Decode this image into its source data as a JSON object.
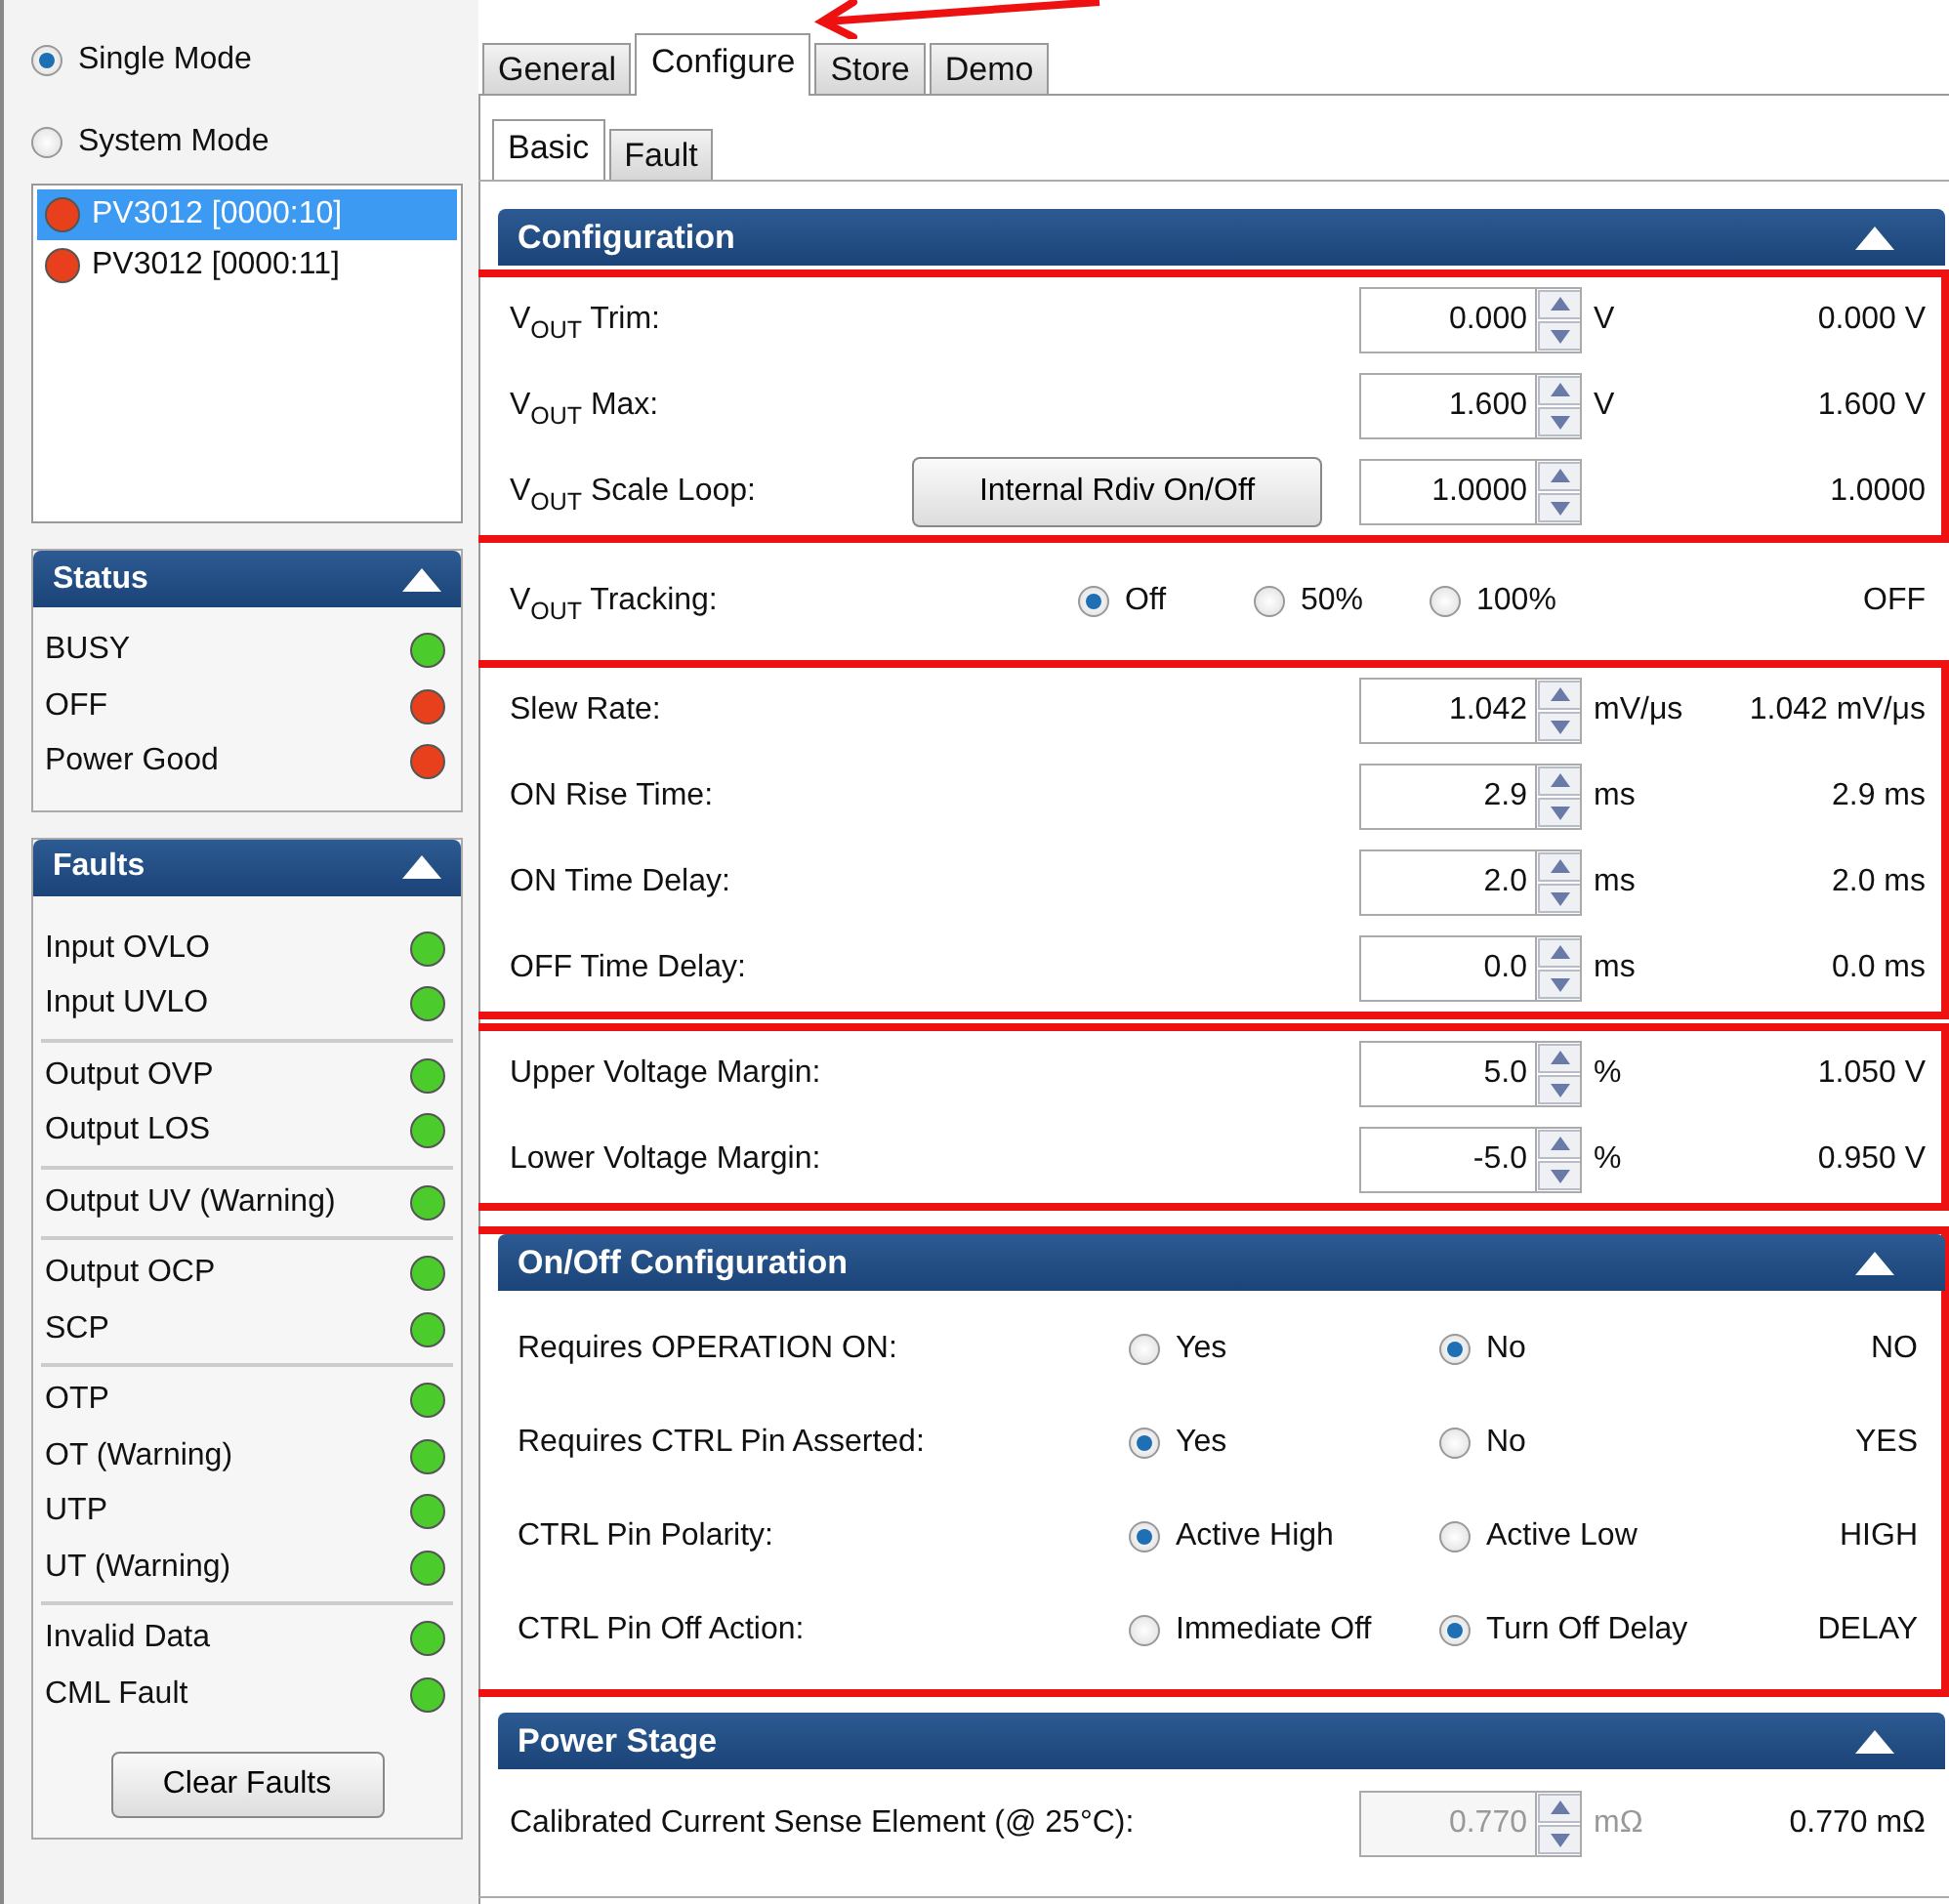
{
  "modes": [
    {
      "label": "Single Mode",
      "selected": true
    },
    {
      "label": "System Mode",
      "selected": false
    }
  ],
  "devices": [
    {
      "label": "PV3012 [0000:10]",
      "selected": true,
      "color": "#e8401c"
    },
    {
      "label": "PV3012 [0000:11]",
      "selected": false,
      "color": "#e8401c"
    }
  ],
  "status": {
    "title": "Status",
    "expanded": true,
    "items": [
      {
        "label": "BUSY",
        "color": "#4ccc2c"
      },
      {
        "label": "OFF",
        "color": "#e8401c"
      },
      {
        "label": "Power Good",
        "color": "#e8401c"
      }
    ]
  },
  "faults": {
    "title": "Faults",
    "expanded": true,
    "groups": [
      [
        {
          "label": "Input OVLO",
          "color": "#4ccc2c"
        },
        {
          "label": "Input UVLO",
          "color": "#4ccc2c"
        }
      ],
      [
        {
          "label": "Output OVP",
          "color": "#4ccc2c"
        },
        {
          "label": "Output LOS",
          "color": "#4ccc2c"
        }
      ],
      [
        {
          "label": "Output UV (Warning)",
          "color": "#4ccc2c"
        }
      ],
      [
        {
          "label": "Output OCP",
          "color": "#4ccc2c"
        },
        {
          "label": "SCP",
          "color": "#4ccc2c"
        }
      ],
      [
        {
          "label": "OTP",
          "color": "#4ccc2c"
        },
        {
          "label": "OT (Warning)",
          "color": "#4ccc2c"
        },
        {
          "label": "UTP",
          "color": "#4ccc2c"
        },
        {
          "label": "UT (Warning)",
          "color": "#4ccc2c"
        }
      ],
      [
        {
          "label": "Invalid Data",
          "color": "#4ccc2c"
        },
        {
          "label": "CML Fault",
          "color": "#4ccc2c"
        }
      ]
    ],
    "button": "Clear Faults"
  },
  "annotation_arrow": true,
  "tabs": [
    {
      "label": "General",
      "selected": false
    },
    {
      "label": "Configure",
      "selected": true
    },
    {
      "label": "Store",
      "selected": false
    },
    {
      "label": "Demo",
      "selected": false
    }
  ],
  "subtabs": [
    {
      "label": "Basic",
      "selected": true
    },
    {
      "label": "Fault",
      "selected": false
    }
  ],
  "sections": [
    {
      "title": "Configuration",
      "expanded": true,
      "highlighted": false,
      "groups": [
        {
          "highlighted": true,
          "rows": [
            {
              "kind": "spin",
              "label": "V$_{OUT}$ Trim:",
              "value": "0.000",
              "unit": "V",
              "reading": "0.000 V",
              "disabled": false
            },
            {
              "kind": "spin",
              "label": "V$_{OUT}$ Max:",
              "value": "1.600",
              "unit": "V",
              "reading": "1.600 V",
              "disabled": false
            },
            {
              "kind": "spin",
              "label": "V$_{OUT}$ Scale Loop:",
              "button": "Internal Rdiv On/Off",
              "value": "1.0000",
              "reading": "1.0000",
              "disabled": false
            }
          ]
        },
        {
          "highlighted": false,
          "rows": [
            {
              "kind": "radio",
              "label": "V$_{OUT}$ Tracking:",
              "options": [
                {
                  "label": "Off",
                  "selected": true
                },
                {
                  "label": "50%",
                  "selected": false
                },
                {
                  "label": "100%",
                  "selected": false
                }
              ],
              "reading": "OFF"
            }
          ]
        },
        {
          "highlighted": true,
          "rows": [
            {
              "kind": "spin",
              "label": "Slew Rate:",
              "value": "1.042",
              "unit": "mV/μs",
              "reading": "1.042 mV/μs",
              "disabled": false
            },
            {
              "kind": "spin",
              "label": "ON Rise Time:",
              "value": "2.9",
              "unit": "ms",
              "reading": "2.9 ms",
              "disabled": false
            },
            {
              "kind": "spin",
              "label": "ON Time Delay:",
              "value": "2.0",
              "unit": "ms",
              "reading": "2.0 ms",
              "disabled": false
            },
            {
              "kind": "spin",
              "label": "OFF Time Delay:",
              "value": "0.0",
              "unit": "ms",
              "reading": "0.0 ms",
              "disabled": false
            }
          ]
        },
        {
          "highlighted": true,
          "rows": [
            {
              "kind": "spin",
              "label": "Upper Voltage Margin:",
              "value": "5.0",
              "unit": "%",
              "reading": "1.050 V",
              "disabled": false
            },
            {
              "kind": "spin",
              "label": "Lower Voltage Margin:",
              "value": "-5.0",
              "unit": "%",
              "reading": "0.950 V",
              "disabled": false
            }
          ]
        }
      ]
    },
    {
      "title": "On/Off Configuration",
      "expanded": true,
      "highlighted": true,
      "groups": [
        {
          "highlighted": false,
          "rows": [
            {
              "kind": "radio",
              "label": "Requires OPERATION ON:",
              "options": [
                {
                  "label": "Yes",
                  "selected": false
                },
                {
                  "label": "No",
                  "selected": true
                }
              ],
              "reading": "NO"
            },
            {
              "kind": "radio",
              "label": "Requires CTRL Pin Asserted:",
              "options": [
                {
                  "label": "Yes",
                  "selected": true
                },
                {
                  "label": "No",
                  "selected": false
                }
              ],
              "reading": "YES"
            },
            {
              "kind": "radio",
              "label": "CTRL Pin Polarity:",
              "options": [
                {
                  "label": "Active High",
                  "selected": true
                },
                {
                  "label": "Active Low",
                  "selected": false
                }
              ],
              "reading": "HIGH"
            },
            {
              "kind": "radio",
              "label": "CTRL Pin Off Action:",
              "options": [
                {
                  "label": "Immediate Off",
                  "selected": false
                },
                {
                  "label": "Turn Off Delay",
                  "selected": true
                }
              ],
              "reading": "DELAY"
            }
          ]
        }
      ]
    },
    {
      "title": "Power Stage",
      "expanded": true,
      "highlighted": false,
      "groups": [
        {
          "highlighted": false,
          "rows": [
            {
              "kind": "spin",
              "label": "Calibrated Current Sense Element (@ 25°C):",
              "value": "0.770",
              "unit": "mΩ",
              "reading": "0.770 mΩ",
              "disabled": true
            }
          ]
        }
      ]
    }
  ]
}
